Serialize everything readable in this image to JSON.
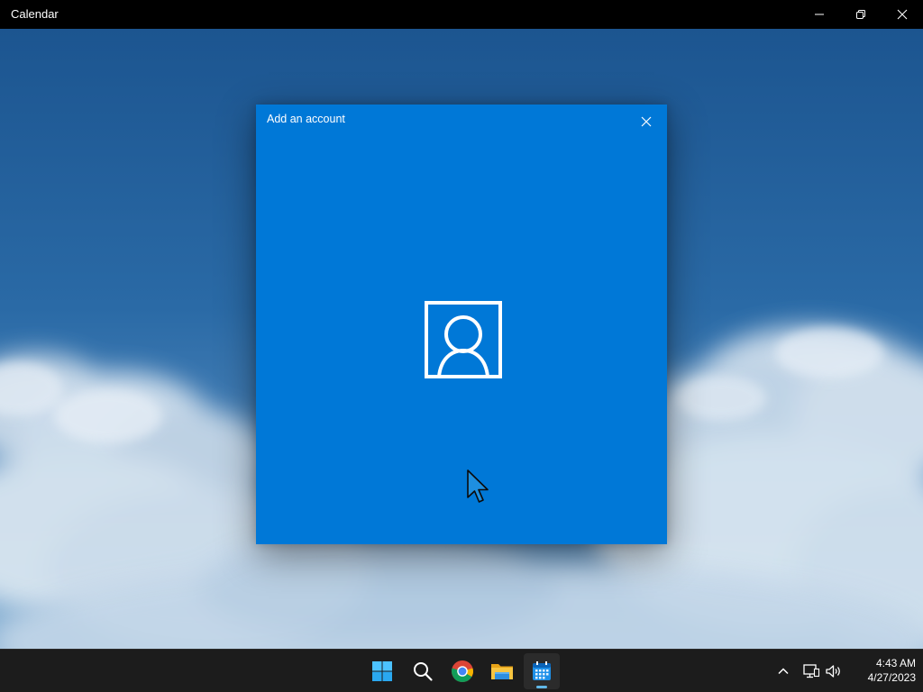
{
  "window": {
    "title": "Calendar",
    "controls": [
      "minimize",
      "maximize",
      "close"
    ]
  },
  "dialog": {
    "title": "Add an account",
    "background": "#0078d7",
    "icon": "account-icon",
    "close_icon": "close-icon"
  },
  "taskbar": {
    "apps": [
      {
        "name": "Start",
        "icon": "windows-start-icon"
      },
      {
        "name": "Search",
        "icon": "search-icon"
      },
      {
        "name": "Google Chrome",
        "icon": "chrome-icon"
      },
      {
        "name": "File Explorer",
        "icon": "folder-icon"
      },
      {
        "name": "Calendar",
        "icon": "calendar-icon",
        "active": true
      }
    ],
    "tray": {
      "icons": [
        "chevron-up-icon",
        "network-icon",
        "volume-icon"
      ],
      "time": "4:43 AM",
      "date": "4/27/2023"
    }
  },
  "colors": {
    "accent": "#0078d7",
    "titlebar": "#000000",
    "taskbar": "#1c1c1c",
    "sky": "#1e5a99"
  }
}
